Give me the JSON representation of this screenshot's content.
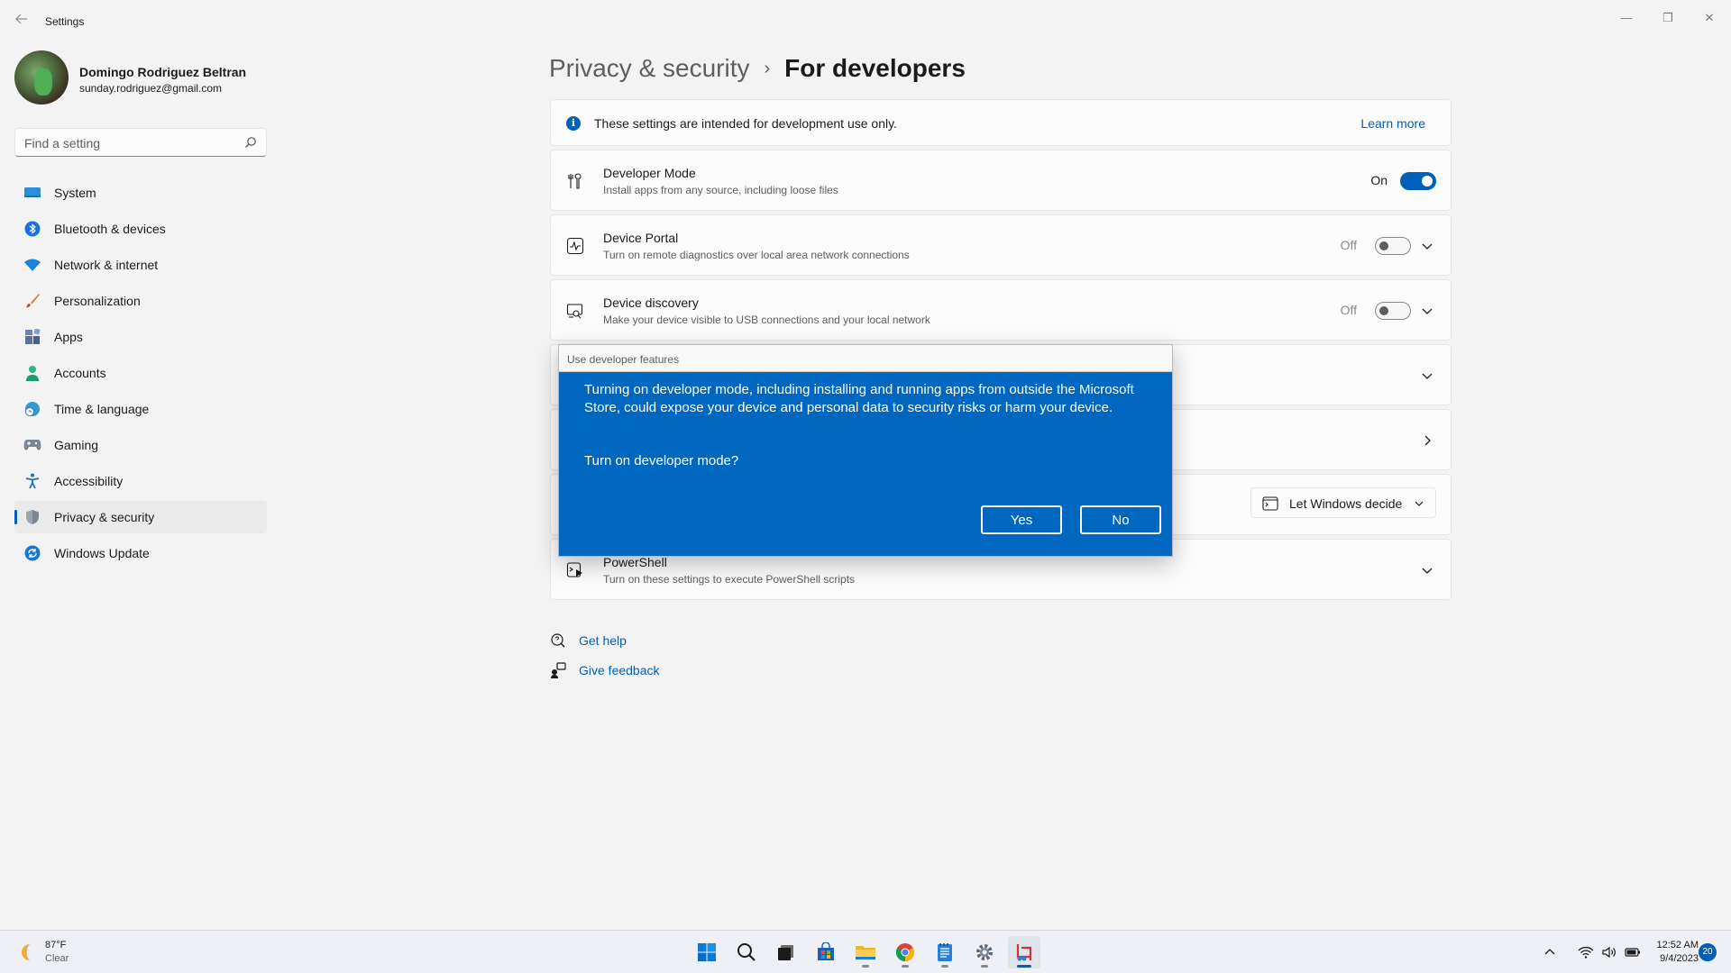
{
  "window": {
    "app_title": "Settings",
    "controls": {
      "minimize": "—",
      "maximize": "❐",
      "close": "✕"
    }
  },
  "user": {
    "name": "Domingo Rodriguez Beltran",
    "email": "sunday.rodriguez@gmail.com"
  },
  "search": {
    "placeholder": "Find a setting"
  },
  "sidebar": {
    "items": [
      {
        "label": "System",
        "icon": "monitor-icon"
      },
      {
        "label": "Bluetooth & devices",
        "icon": "bluetooth-icon"
      },
      {
        "label": "Network & internet",
        "icon": "wifi-icon"
      },
      {
        "label": "Personalization",
        "icon": "brush-icon"
      },
      {
        "label": "Apps",
        "icon": "apps-icon"
      },
      {
        "label": "Accounts",
        "icon": "person-icon"
      },
      {
        "label": "Time & language",
        "icon": "globe-clock-icon"
      },
      {
        "label": "Gaming",
        "icon": "gamepad-icon"
      },
      {
        "label": "Accessibility",
        "icon": "accessibility-icon"
      },
      {
        "label": "Privacy & security",
        "icon": "shield-icon",
        "active": true
      },
      {
        "label": "Windows Update",
        "icon": "update-icon"
      }
    ]
  },
  "breadcrumb": {
    "parent": "Privacy & security",
    "separator": "›",
    "current": "For developers"
  },
  "info_bar": {
    "text": "These settings are intended for development use only.",
    "link": "Learn more"
  },
  "settings": {
    "developer_mode": {
      "title": "Developer Mode",
      "desc": "Install apps from any source, including loose files",
      "state": "On"
    },
    "device_portal": {
      "title": "Device Portal",
      "desc": "Turn on remote diagnostics over local area network connections",
      "state": "Off"
    },
    "device_discovery": {
      "title": "Device discovery",
      "desc": "Make your device visible to USB connections and your local network",
      "state": "Off"
    },
    "terminal": {
      "dropdown_value": "Let Windows decide"
    },
    "powershell": {
      "title": "PowerShell",
      "desc": "Turn on these settings to execute PowerShell scripts"
    }
  },
  "links": {
    "get_help": "Get help",
    "give_feedback": "Give feedback"
  },
  "dialog": {
    "title": "Use developer features",
    "message": "Turning on developer mode, including installing and running apps from outside the Microsoft Store, could expose your device and personal data to security risks or harm your device.",
    "question": "Turn on developer mode?",
    "yes": "Yes",
    "no": "No"
  },
  "taskbar": {
    "weather_temp": "87°F",
    "weather_cond": "Clear",
    "time": "12:52 AM",
    "date": "9/4/2023",
    "notifications": "20"
  },
  "colors": {
    "accent": "#005fb8",
    "dialog_bg": "#0067c0",
    "background": "#f3f3f3"
  }
}
